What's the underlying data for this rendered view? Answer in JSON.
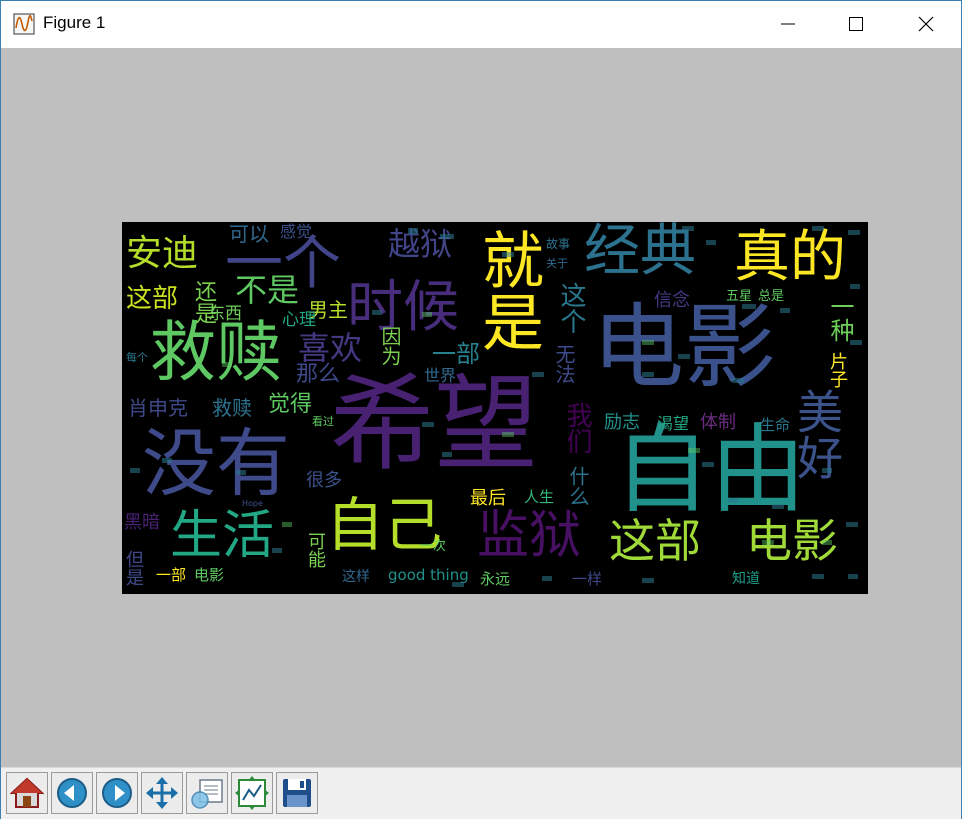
{
  "window": {
    "title": "Figure 1"
  },
  "toolbar": {
    "buttons": [
      {
        "name": "home"
      },
      {
        "name": "back"
      },
      {
        "name": "forward"
      },
      {
        "name": "pan"
      },
      {
        "name": "zoom"
      },
      {
        "name": "configure-subplots"
      },
      {
        "name": "save"
      }
    ]
  },
  "wordcloud": {
    "words": [
      {
        "text": "希望",
        "color": "#482173"
      },
      {
        "text": "电影",
        "color": "#3b518b"
      },
      {
        "text": "自由",
        "color": "#21918c"
      },
      {
        "text": "没有",
        "color": "#3e4a89"
      },
      {
        "text": "救赎",
        "color": "#5ec962"
      },
      {
        "text": "一个",
        "color": "#414487"
      },
      {
        "text": "时候",
        "color": "#472d7b"
      },
      {
        "text": "就是",
        "color": "#fde725"
      },
      {
        "text": "经典",
        "color": "#2c728e"
      },
      {
        "text": "真的",
        "color": "#fde725"
      },
      {
        "text": "自己",
        "color": "#b5de2b"
      },
      {
        "text": "监狱",
        "color": "#471063"
      },
      {
        "text": "生活",
        "color": "#22a884"
      },
      {
        "text": "这部",
        "color": "#a0da39"
      },
      {
        "text": "电影",
        "color": "#a0da39"
      },
      {
        "text": "美好",
        "color": "#3b528b"
      },
      {
        "text": "安迪",
        "color": "#b5de2b"
      },
      {
        "text": "越狱",
        "color": "#414487"
      },
      {
        "text": "不是",
        "color": "#5ec962"
      },
      {
        "text": "可以",
        "color": "#31688e"
      },
      {
        "text": "感觉",
        "color": "#3b528b"
      },
      {
        "text": "这部",
        "color": "#c8e020"
      },
      {
        "text": "还是",
        "color": "#7ad151"
      },
      {
        "text": "喜欢",
        "color": "#443983"
      },
      {
        "text": "那么",
        "color": "#3e4989"
      },
      {
        "text": "男主",
        "color": "#b5de2b"
      },
      {
        "text": "东西",
        "color": "#6ece58"
      },
      {
        "text": "心理",
        "color": "#22a884"
      },
      {
        "text": "因为",
        "color": "#7ad151"
      },
      {
        "text": "一部",
        "color": "#26828e"
      },
      {
        "text": "这个",
        "color": "#2a788e"
      },
      {
        "text": "无法",
        "color": "#3e4a89"
      },
      {
        "text": "一种",
        "color": "#6ece58"
      },
      {
        "text": "信念",
        "color": "#443983"
      },
      {
        "text": "五星",
        "color": "#5ec962"
      },
      {
        "text": "总是",
        "color": "#5ec962"
      },
      {
        "text": "片子",
        "color": "#fde725"
      },
      {
        "text": "肖申克",
        "color": "#3e4989"
      },
      {
        "text": "救赎",
        "color": "#2c728e"
      },
      {
        "text": "觉得",
        "color": "#5ec962"
      },
      {
        "text": "世界",
        "color": "#31688e"
      },
      {
        "text": "我们",
        "color": "#440154"
      },
      {
        "text": "励志",
        "color": "#21918c"
      },
      {
        "text": "渴望",
        "color": "#22a884"
      },
      {
        "text": "体制",
        "color": "#6a2c80"
      },
      {
        "text": "生命",
        "color": "#2a788e"
      },
      {
        "text": "黑暗",
        "color": "#482173"
      },
      {
        "text": "很多",
        "color": "#3b528b"
      },
      {
        "text": "什么",
        "color": "#2c728e"
      },
      {
        "text": "最后",
        "color": "#fde725"
      },
      {
        "text": "人生",
        "color": "#35b779"
      },
      {
        "text": "但是",
        "color": "#3e4989"
      },
      {
        "text": "可能",
        "color": "#7ad151"
      },
      {
        "text": "一部",
        "color": "#fde725"
      },
      {
        "text": "电影",
        "color": "#5ec962"
      },
      {
        "text": "这样",
        "color": "#31688e"
      },
      {
        "text": "good thing",
        "color": "#21918c"
      },
      {
        "text": "永远",
        "color": "#5ec962"
      },
      {
        "text": "一样",
        "color": "#3e4989"
      },
      {
        "text": "知道",
        "color": "#1f9e89"
      },
      {
        "text": "一次",
        "color": "#5ec962"
      },
      {
        "text": "每个",
        "color": "#2a788e"
      },
      {
        "text": "看过",
        "color": "#5ec962"
      },
      {
        "text": "故事",
        "color": "#2c728e"
      },
      {
        "text": "关于",
        "color": "#31688e"
      },
      {
        "text": "Hope",
        "color": "#3b528b"
      }
    ]
  }
}
